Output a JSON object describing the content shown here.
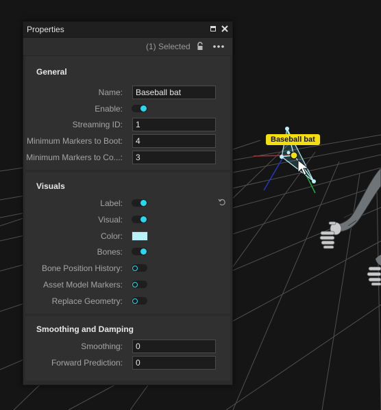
{
  "window": {
    "title": "Properties",
    "selected_text": "(1) Selected"
  },
  "general": {
    "title": "General",
    "fields": [
      {
        "label": "Name:",
        "value": "Baseball bat"
      },
      {
        "label": "Enable:",
        "toggle": true
      },
      {
        "label": "Streaming ID:",
        "value": "1"
      },
      {
        "label": "Minimum Markers to Boot:",
        "value": "4"
      },
      {
        "label": "Minimum Markers to Co...:",
        "value": "3"
      }
    ]
  },
  "visuals": {
    "title": "Visuals",
    "fields": [
      {
        "label": "Label:",
        "toggle": true
      },
      {
        "label": "Visual:",
        "toggle": true
      },
      {
        "label": "Color:",
        "color": "#b8f2f8"
      },
      {
        "label": "Bones:",
        "toggle": true
      },
      {
        "label": "Bone Position History:",
        "toggle": false
      },
      {
        "label": "Asset Model Markers:",
        "toggle": false
      },
      {
        "label": "Replace Geometry:",
        "toggle": false
      }
    ]
  },
  "smoothing": {
    "title": "Smoothing and Damping",
    "fields": [
      {
        "label": "Smoothing:",
        "value": "0"
      },
      {
        "label": "Forward Prediction:",
        "value": "0"
      }
    ]
  },
  "viewport": {
    "asset_label": "Baseball bat"
  },
  "icons": [
    "maximize-icon",
    "close-icon",
    "lock-icon",
    "more-icon",
    "reset-icon",
    "cursor-icon"
  ],
  "colors": {
    "accent": "#28d8ee",
    "panel_bg": "#2b2b2b",
    "label_bg": "#f5de10"
  }
}
